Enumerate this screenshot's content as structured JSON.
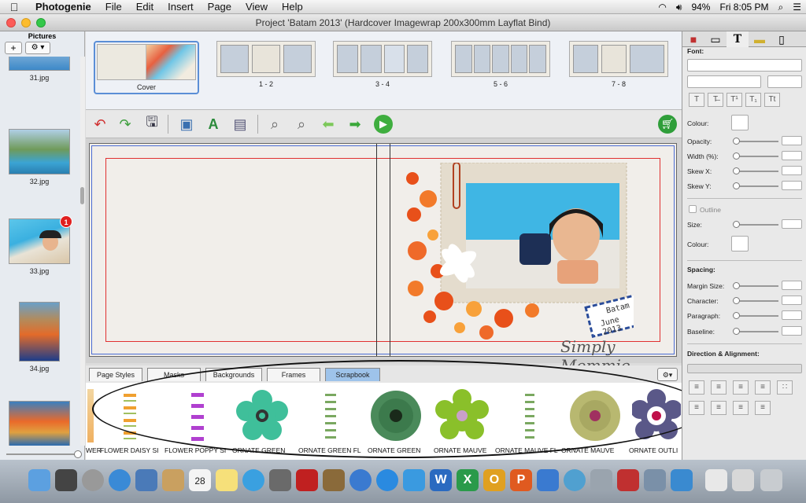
{
  "menubar": {
    "app": "Photogenie",
    "items": [
      "File",
      "Edit",
      "Insert",
      "Page",
      "View",
      "Help"
    ],
    "battery": "94%",
    "clock": "Fri 8:05 PM"
  },
  "window": {
    "title": "Project 'Batam 2013' (Hardcover Imagewrap 200x300mm Layflat Bind)"
  },
  "sidebar": {
    "title": "Pictures",
    "add_label": "+",
    "gear_label": "⚙ ▾",
    "photos": [
      {
        "label": "31.jpg"
      },
      {
        "label": "32.jpg"
      },
      {
        "label": "33.jpg",
        "badge": "1"
      },
      {
        "label": "34.jpg"
      },
      {
        "label": ""
      }
    ]
  },
  "pages": [
    {
      "label": "Cover"
    },
    {
      "label": "1 - 2"
    },
    {
      "label": "3 - 4"
    },
    {
      "label": "5 - 6"
    },
    {
      "label": "7 - 8"
    }
  ],
  "canvas": {
    "stamp_line1": "Batam",
    "stamp_line2": "June 2013",
    "watermark": "Simply Mommie"
  },
  "tabs": [
    "Page Styles",
    "Masks",
    "Backgrounds",
    "Frames",
    "Scrapbook"
  ],
  "tray": [
    {
      "label": "WER"
    },
    {
      "label": "FLOWER DAISY SI"
    },
    {
      "label": "FLOWER POPPY SI"
    },
    {
      "label": "ORNATE GREEN"
    },
    {
      "label": "ORNATE GREEN FL"
    },
    {
      "label": "ORNATE GREEN"
    },
    {
      "label": "ORNATE MAUVE"
    },
    {
      "label": "ORNATE MAUVE FL"
    },
    {
      "label": "ORNATE MAUVE"
    },
    {
      "label": "ORNATE OUTLI"
    }
  ],
  "panel": {
    "font_label": "Font:",
    "colour_label": "Colour:",
    "opacity_label": "Opacity:",
    "width_label": "Width (%):",
    "skewx_label": "Skew X:",
    "skewy_label": "Skew Y:",
    "outline_label": "Outline",
    "size_label": "Size:",
    "colour2_label": "Colour:",
    "spacing_label": "Spacing:",
    "margin_label": "Margin Size:",
    "character_label": "Character:",
    "paragraph_label": "Paragraph:",
    "baseline_label": "Baseline:",
    "direction_label": "Direction & Alignment:"
  },
  "colors": {
    "accent": "#9ec3ea",
    "guide_red": "#e03030",
    "guide_blue": "#4a6cd4"
  }
}
